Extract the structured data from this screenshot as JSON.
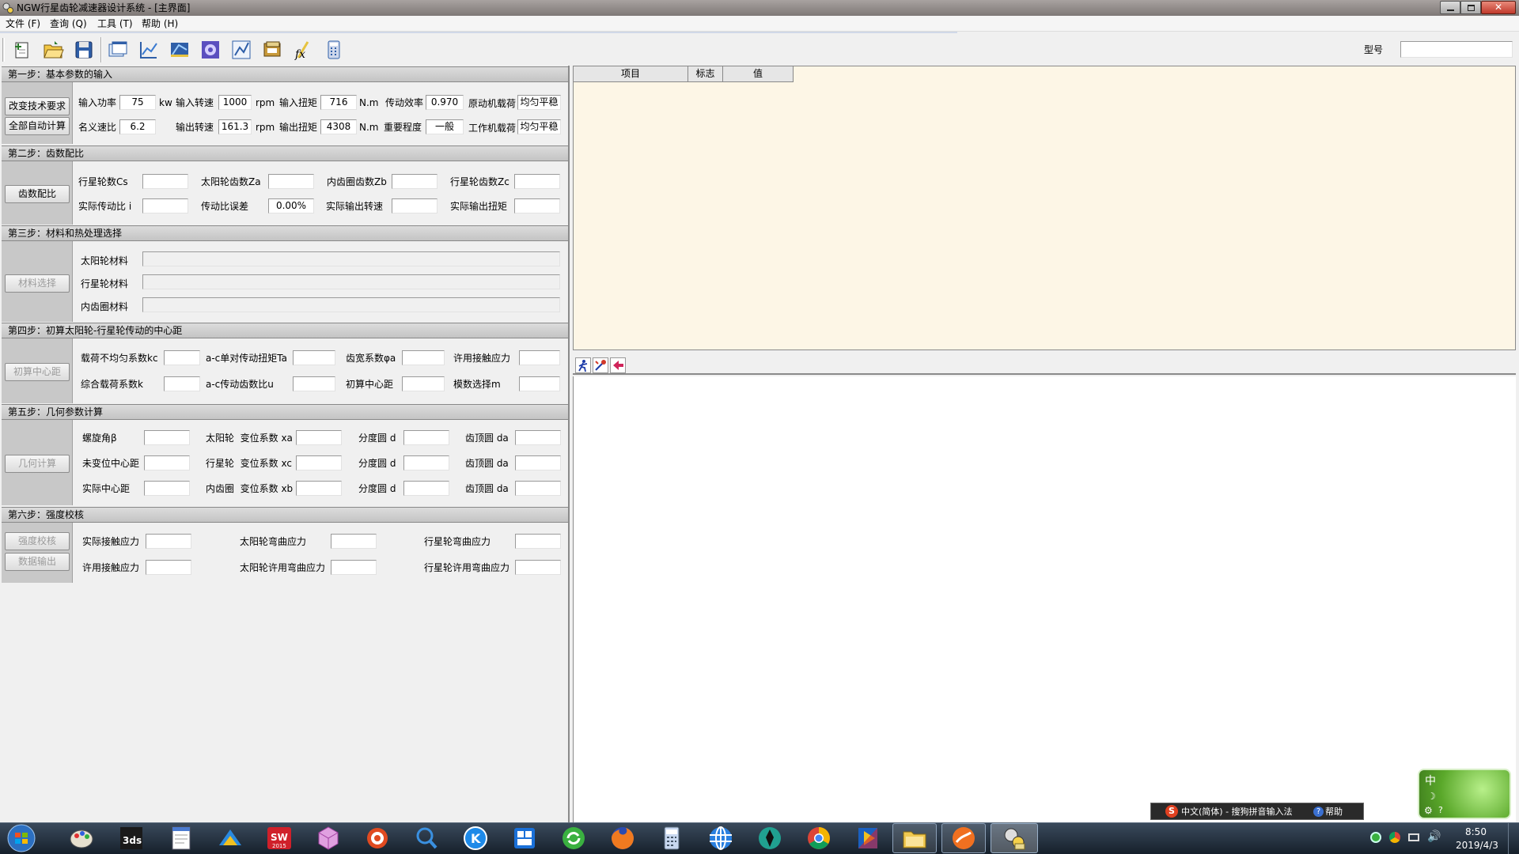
{
  "window": {
    "title": "NGW行星齿轮减速器设计系统 - [主界面]"
  },
  "menu": [
    {
      "label": "文件 (F)"
    },
    {
      "label": "查询 (Q)"
    },
    {
      "label": "工具 (T)"
    },
    {
      "label": "帮助 (H)"
    }
  ],
  "toolbar": {
    "icons": [
      "new-icon",
      "open-folder-icon",
      "save-icon",
      "window-icon",
      "chart-icon",
      "drawing-icon",
      "gear-disc-icon",
      "graph-icon",
      "database-icon",
      "formula-fx-icon",
      "calculator-icon"
    ],
    "model_label": "型号",
    "model_value": ""
  },
  "step1": {
    "title": "第一步：基本参数的输入",
    "btn_change": "改变技术要求",
    "btn_auto": "全部自动计算",
    "input_power": {
      "label": "输入功率",
      "value": "75",
      "unit": "kw"
    },
    "input_speed": {
      "label": "输入转速",
      "value": "1000",
      "unit": "rpm"
    },
    "input_torque": {
      "label": "输入扭矩",
      "value": "716",
      "unit": "N.m"
    },
    "efficiency": {
      "label": "传动效率",
      "value": "0.970"
    },
    "prime_load": {
      "label": "原动机载荷",
      "value": "均匀平稳"
    },
    "nominal_ratio": {
      "label": "名义速比",
      "value": "6.2"
    },
    "output_speed": {
      "label": "输出转速",
      "value": "161.3",
      "unit": "rpm"
    },
    "output_torque": {
      "label": "输出扭矩",
      "value": "4308",
      "unit": "N.m"
    },
    "importance": {
      "label": "重要程度",
      "value": "一般"
    },
    "work_load": {
      "label": "工作机载荷",
      "value": "均匀平稳"
    }
  },
  "step2": {
    "title": "第二步：齿数配比",
    "btn": "齿数配比",
    "planet_count": {
      "label": "行星轮数Cs",
      "value": ""
    },
    "sun_teeth": {
      "label": "太阳轮齿数Za",
      "value": ""
    },
    "ring_teeth": {
      "label": "内齿圈齿数Zb",
      "value": ""
    },
    "planet_teeth": {
      "label": "行星轮齿数Zc",
      "value": ""
    },
    "actual_ratio": {
      "label": "实际传动比 i",
      "value": ""
    },
    "ratio_error": {
      "label": "传动比误差",
      "value": "0.00%"
    },
    "actual_out_speed": {
      "label": "实际输出转速",
      "value": ""
    },
    "actual_out_torque": {
      "label": "实际输出扭矩",
      "value": ""
    }
  },
  "step3": {
    "title": "第三步：材料和热处理选择",
    "btn": "材料选择",
    "sun_material": {
      "label": "太阳轮材料",
      "value": ""
    },
    "planet_material": {
      "label": "行星轮材料",
      "value": ""
    },
    "ring_material": {
      "label": "内齿圈材料",
      "value": ""
    }
  },
  "step4": {
    "title": "第四步：初算太阳轮-行星轮传动的中心距",
    "btn": "初算中心距",
    "kc": {
      "label": "载荷不均匀系数kc",
      "value": ""
    },
    "ta": {
      "label": "a-c单对传动扭矩Ta",
      "value": ""
    },
    "phi_a": {
      "label": "齿宽系数φa",
      "value": ""
    },
    "allow_contact": {
      "label": "许用接触应力",
      "value": ""
    },
    "k": {
      "label": "综合载荷系数k",
      "value": ""
    },
    "u": {
      "label": "a-c传动齿数比u",
      "value": ""
    },
    "center_dist": {
      "label": "初算中心距",
      "value": ""
    },
    "module": {
      "label": "模数选择m",
      "value": ""
    }
  },
  "step5": {
    "title": "第五步：几何参数计算",
    "btn": "几何计算",
    "helix": {
      "label": "螺旋角β",
      "value": ""
    },
    "sun_xa": {
      "label": "太阳轮  变位系数 xa",
      "value": ""
    },
    "sun_d": {
      "label": "分度圆 d",
      "value": ""
    },
    "sun_da": {
      "label": "齿顶圆 da",
      "value": ""
    },
    "unmod_center": {
      "label": "未变位中心距",
      "value": ""
    },
    "planet_xc": {
      "label": "行星轮  变位系数 xc",
      "value": ""
    },
    "planet_d": {
      "label": "分度圆 d",
      "value": ""
    },
    "planet_da": {
      "label": "齿顶圆 da",
      "value": ""
    },
    "actual_center": {
      "label": "实际中心距",
      "value": ""
    },
    "ring_xb": {
      "label": "内齿圈  变位系数 xb",
      "value": ""
    },
    "ring_d": {
      "label": "分度圆 d",
      "value": ""
    },
    "ring_da": {
      "label": "齿顶圆 da",
      "value": ""
    }
  },
  "step6": {
    "title": "第六步：强度校核",
    "btn_check": "强度校核",
    "btn_output": "数据输出",
    "actual_contact": {
      "label": "实际接触应力",
      "value": ""
    },
    "sun_bending": {
      "label": "太阳轮弯曲应力",
      "value": ""
    },
    "planet_bending": {
      "label": "行星轮弯曲应力",
      "value": ""
    },
    "allow_contact": {
      "label": "许用接触应力",
      "value": ""
    },
    "sun_allow_bending": {
      "label": "太阳轮许用弯曲应力",
      "value": ""
    },
    "planet_allow_bending": {
      "label": "行星轮许用弯曲应力",
      "value": ""
    }
  },
  "grid": {
    "columns": [
      "项目",
      "标志",
      "值"
    ]
  },
  "ime": {
    "text": "中文(简体) - 搜狗拼音输入法",
    "help": "帮助",
    "badge": "中"
  },
  "taskbar": {
    "apps": [
      "windows-start-icon",
      "paint-icon",
      "3ds-max-icon",
      "notepad-icon",
      "kuaipan-icon",
      "solidworks-2015-icon",
      "cube-app-icon",
      "settings-gear-app-icon",
      "search-app-icon",
      "k-app-icon",
      "tiles-app-icon",
      "refresh-app-icon",
      "firefox-icon",
      "calculator-app-icon",
      "globe-app-icon",
      "pen-app-icon",
      "chrome-icon",
      "media-app-icon",
      "file-explorer-icon",
      "orange-app-icon",
      "ngw-app-icon"
    ],
    "time": "8:50",
    "date": "2019/4/3"
  },
  "colors": {
    "grid_bg": "#fdf6e6",
    "section_bg": "#c8c8c8",
    "titlebar": "#8a8480",
    "taskbar": "#1c2733"
  }
}
